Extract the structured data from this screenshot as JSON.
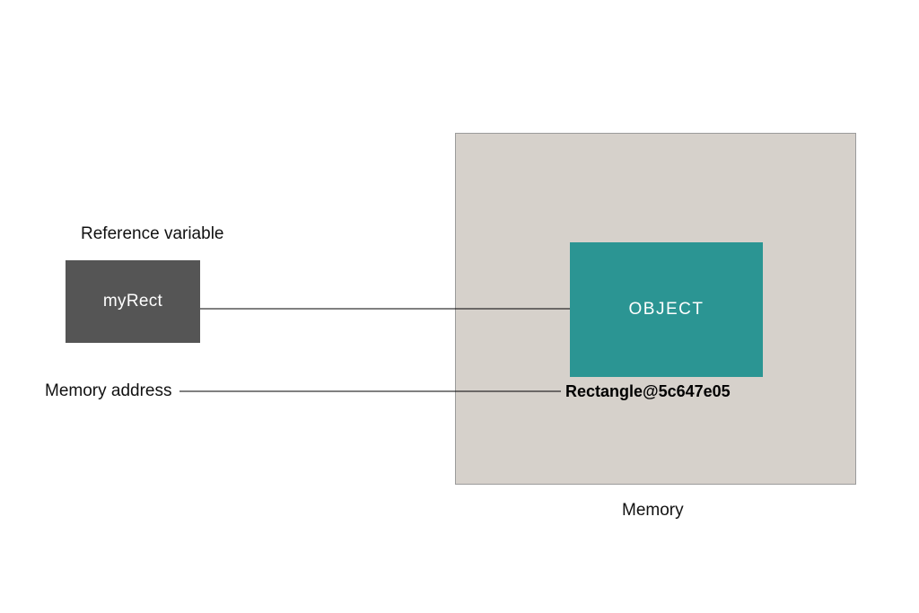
{
  "labels": {
    "reference_variable": "Reference variable",
    "memory_address": "Memory address",
    "memory_caption": "Memory"
  },
  "reference_box": {
    "text": "myRect"
  },
  "object_box": {
    "text": "OBJECT"
  },
  "address_text": "Rectangle@5c647e05",
  "colors": {
    "ref_box_bg": "#555555",
    "object_bg": "#2b9593",
    "memory_bg": "#d6d1cb",
    "memory_border": "#9b9b9b"
  }
}
